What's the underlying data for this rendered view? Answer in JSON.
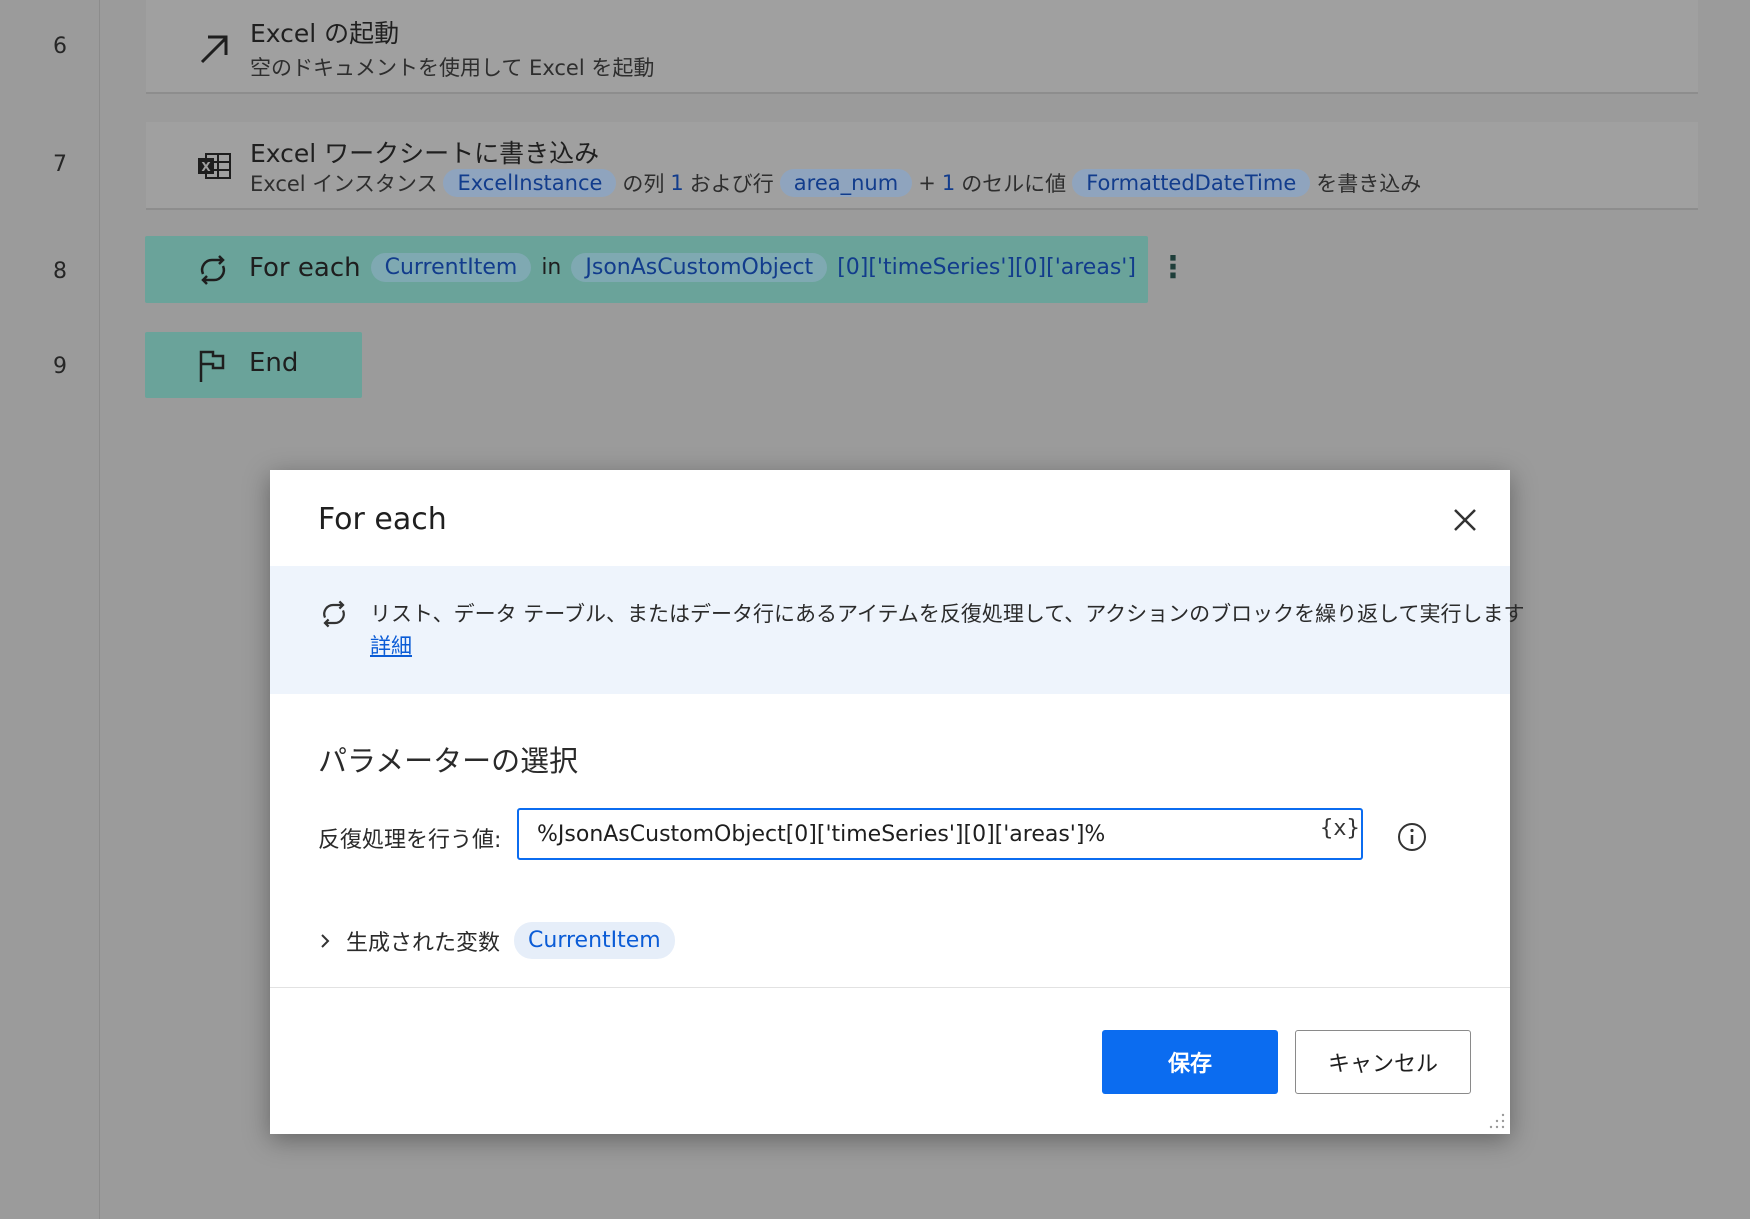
{
  "flow": {
    "rows": [
      {
        "line": "6",
        "title": "Excel の起動",
        "subtitle": "空のドキュメントを使用して Excel を起動",
        "icon": "arrow-up-right-icon"
      },
      {
        "line": "7",
        "title": "Excel ワークシートに書き込み",
        "icon": "excel-icon",
        "sub": {
          "p1": "Excel インスタンス",
          "v1": "ExcelInstance",
          "p2": "の列",
          "n1": "1",
          "p3": "および行",
          "v2": "area_num",
          "p4": "+",
          "n2": "1",
          "p5": "のセルに値",
          "v3": "FormattedDateTime",
          "p6": "を書き込み"
        }
      },
      {
        "line": "8",
        "keyword": "For each",
        "var": "CurrentItem",
        "in": "in",
        "source_var": "JsonAsCustomObject",
        "path": "[0]['timeSeries'][0]['areas']",
        "menu": "⋮",
        "icon": "loop-icon"
      },
      {
        "line": "9",
        "keyword": "End",
        "icon": "flag-icon"
      }
    ]
  },
  "dialog": {
    "title": "For each",
    "description": "リスト、データ テーブル、またはデータ行にあるアイテムを反復処理して、アクションのブロックを繰り返して実行します",
    "details_link": "詳細",
    "section_title": "パラメーターの選択",
    "field_label": "反復処理を行う値:",
    "field_value": "%JsonAsCustomObject[0]['timeSeries'][0]['areas']%",
    "var_button": "{x}",
    "generated_vars_label": "生成された変数",
    "generated_var": "CurrentItem",
    "save_label": "保存",
    "cancel_label": "キャンセル"
  },
  "colors": {
    "accent": "#0b6cf0",
    "overlay": "#9b9b9b",
    "loop_highlight": "#6aa39a"
  }
}
